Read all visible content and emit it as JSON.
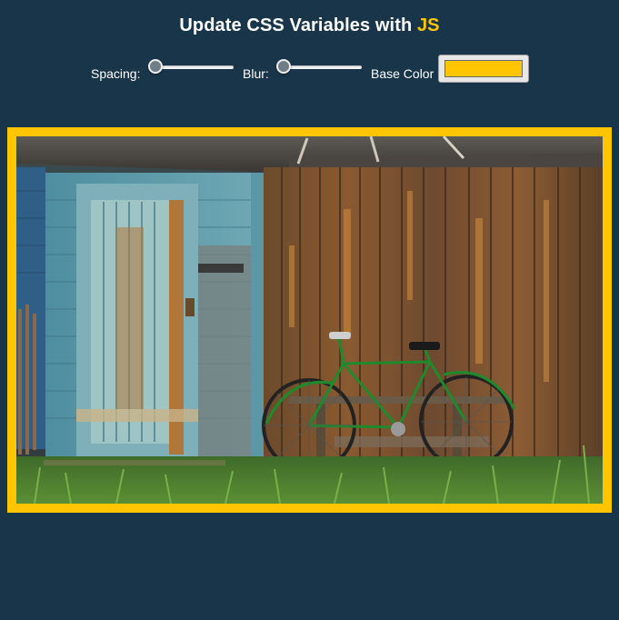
{
  "heading": {
    "text": "Update CSS Variables with ",
    "highlight": "JS"
  },
  "controls": {
    "spacing": {
      "label": "Spacing:",
      "value": 10,
      "min": 10,
      "max": 200
    },
    "blur": {
      "label": "Blur:",
      "value": 0,
      "min": 0,
      "max": 25
    },
    "base": {
      "label": "Base Color",
      "value": "#ffc600"
    }
  },
  "colors": {
    "background": "#193549",
    "accent": "#ffc600"
  },
  "image": {
    "subject": "wooden-shed-with-green-bicycle-photo"
  }
}
